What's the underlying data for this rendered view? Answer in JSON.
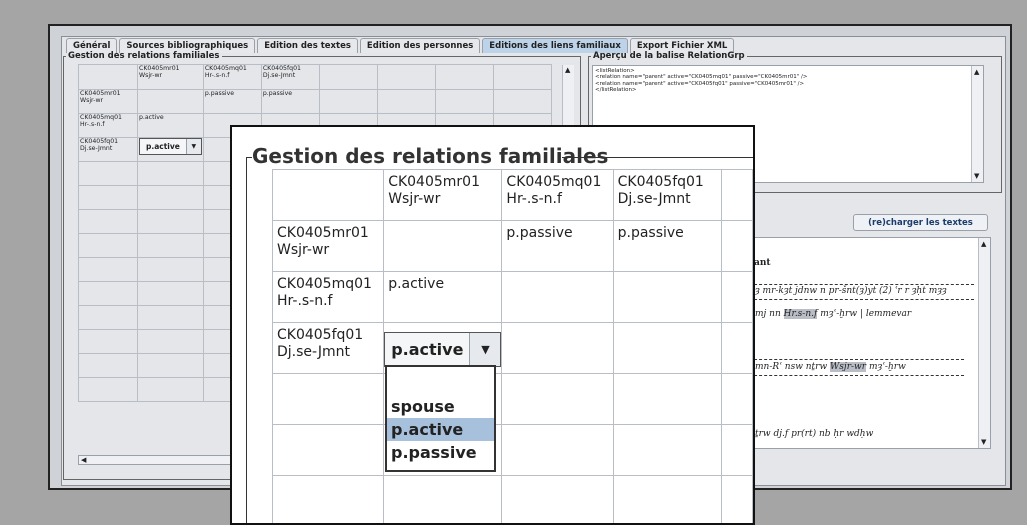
{
  "tabs": [
    "Général",
    "Sources bibliographiques",
    "Edition des textes",
    "Edition des personnes",
    "Editions des liens familiaux",
    "Export Fichier XML"
  ],
  "active_tab_index": 4,
  "relations_panel": {
    "title": "Gestion des relations familiales",
    "col_headers": [
      {
        "code": "CK0405mr01",
        "name": "Wsjr-wr"
      },
      {
        "code": "CK0405mq01",
        "name": "Hr-.s-n.f"
      },
      {
        "code": "CK0405fq01",
        "name": "Dj.se-Jmnt"
      }
    ],
    "rows": [
      {
        "code": "CK0405mr01",
        "name": "Wsjr-wr",
        "cells": [
          "",
          "p.passive",
          "p.passive"
        ]
      },
      {
        "code": "CK0405mq01",
        "name": "Hr-.s-n.f",
        "cells": [
          "p.active",
          "",
          ""
        ]
      },
      {
        "code": "CK0405fq01",
        "name": "Dj.se-Jmnt",
        "cells": [
          "p.active",
          "",
          ""
        ]
      }
    ],
    "editing_value": "p.active",
    "dropdown_options": [
      "spouse",
      "p.active",
      "p.passive"
    ],
    "dropdown_selected": "p.active"
  },
  "xml_panel": {
    "title": "Aperçu de la balise RelationGrp",
    "lines": [
      "<listRelation>",
      "<relation name=\"parent\" active=\"CK0405mq01\" passive=\"CK0405mr01\" />",
      "<relation name=\"parent\" active=\"CK0405fq01\" passive=\"CK0405mr01\" />",
      "</listRelation>"
    ]
  },
  "texts_panel": {
    "reload_label": "(re)charger les textes",
    "heading_fragment": "ant",
    "line1": "ȝ mr-kȝt jdnw n pr-šnt(ȝ)yt (2) ʿr r ȝḥt mȝȝ",
    "line2_pre": "mj nn",
    "line2_hl": "Hr.s-n.f",
    "line2_post": "mȝʿ-ḫrw",
    "line2_tail": "lemmevar",
    "line3_pre": "mn-Rʿ nsw nṯrw",
    "line3_hl": "Wsjr-wr",
    "line3_post": "mȝʿ-ḫrw",
    "line4": "ṯrw dj.f pr(rt) nb ḥr wdḥw"
  },
  "colors": {
    "active_tab": "#bcd3ea",
    "selected_option": "#a7c0db",
    "highlight": "#b9bec6"
  }
}
